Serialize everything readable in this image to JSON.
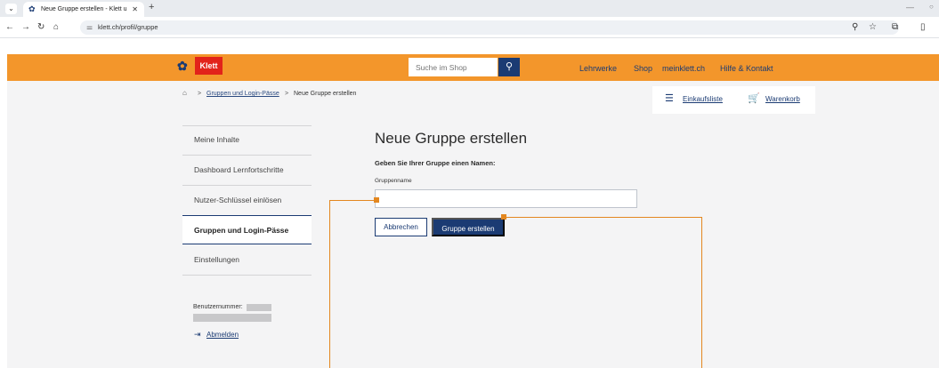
{
  "browser": {
    "tab_title": "Neue Gruppe erstellen - Klett u",
    "tab_close": "✕",
    "new_tab": "+",
    "url": "klett.ch/profil/gruppe",
    "icons": [
      "tab-dropdown-icon",
      "favicon-icon",
      "back-icon",
      "forward-icon",
      "reload-icon",
      "home-icon",
      "site-settings-icon",
      "zoom-icon",
      "bookmark-star-icon",
      "extensions-icon",
      "sidepanel-icon",
      "minimize-icon",
      "maximize-icon"
    ]
  },
  "header": {
    "logo_text": "Klett",
    "search_placeholder": "Suche im Shop",
    "nav": [
      "Lehrwerke",
      "Shop",
      "meinklett.ch",
      "Hilfe & Kontakt"
    ],
    "colors": {
      "bar": "#f3962b",
      "brand_blue": "#1b3b73",
      "logo_red": "#e2231a"
    }
  },
  "breadcrumb": {
    "parent": "Gruppen und Login-Pässe",
    "current": "Neue Gruppe erstellen",
    "separator": ">"
  },
  "cart": {
    "shopping_list": "Einkaufsliste",
    "basket": "Warenkorb"
  },
  "sidebar": {
    "items": [
      {
        "label": "Meine Inhalte",
        "active": false
      },
      {
        "label": "Dashboard Lernfortschritte",
        "active": false
      },
      {
        "label": "Nutzer-Schlüssel einlösen",
        "active": false
      },
      {
        "label": "Gruppen und Login-Pässe",
        "active": true
      },
      {
        "label": "Einstellungen",
        "active": false
      }
    ],
    "user_number_label": "Benutzernummer:",
    "logout": "Abmelden"
  },
  "form": {
    "title": "Neue Gruppe erstellen",
    "prompt": "Geben Sie Ihrer Gruppe einen Namen:",
    "field_label": "Gruppenname",
    "field_value": "",
    "cancel": "Abbrechen",
    "submit": "Gruppe erstellen"
  },
  "annotation_color": "#e3871f"
}
